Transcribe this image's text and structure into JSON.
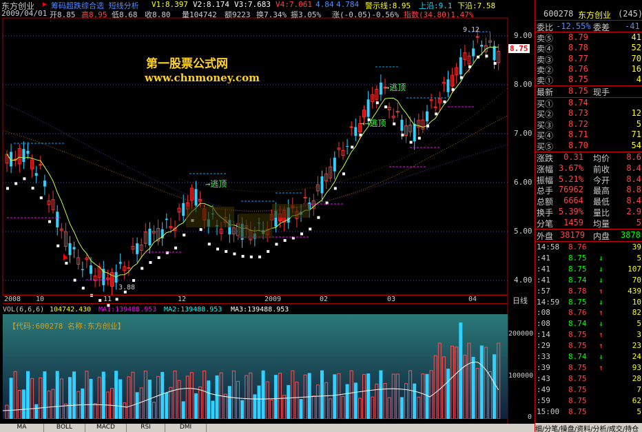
{
  "header": {
    "stock_name": "东方创业",
    "formula": "筹码超跌综合选 短线分析",
    "v1": "V1:8.397",
    "v2": "V2:8.174",
    "v3": "V3:7.683",
    "v4": "V4:7.061",
    "v5": "4.84",
    "v6": "4.784",
    "warn": "警示线:8.95",
    "upper": "上沿:9.1",
    "lower": "下沿:7.58",
    "date": "2009/04/01",
    "open": "开8.85",
    "high": "高8.95",
    "low": "低8.68",
    "close": "收8.80",
    "volume": "量104742",
    "amount": "额9223",
    "turnover": "换7.34%",
    "amplitude": "振3.05%",
    "change": "涨(-0.05)-0.56%",
    "index": "指数(34.80)1.47%"
  },
  "watermark": {
    "title": "第一股票公式网",
    "url": "www.chnmoney.com"
  },
  "price_axis": {
    "labels": [
      "9.00",
      "8.00",
      "7.00",
      "6.00",
      "5.00",
      "4.00"
    ],
    "current": "8.75",
    "high_mark": "9.12",
    "low_mark": "3.88"
  },
  "annotations": [
    "逃顶",
    "逃顶",
    "逃顶"
  ],
  "time_axis": [
    "2008",
    "10",
    "11",
    "12",
    "2009",
    "02",
    "03",
    "04"
  ],
  "time_axis_right": "日线",
  "volume_header": {
    "title": "VOL(6,6,6)",
    "vol": "104742.430",
    "ma1": "MA1:139488.953",
    "ma2": "MA2:139488.953",
    "ma3": "MA3:139488.953",
    "code_line": "【代码:600278 名称:东方创业】"
  },
  "volume_axis": [
    "200000",
    "100000",
    "0"
  ],
  "tabs": [
    "MA",
    "BOLL",
    "MACD",
    "RSI",
    "DMI"
  ],
  "quote": {
    "code": "600278",
    "name": "东方创业",
    "num": "(245)",
    "weibi_label": "委比",
    "weibi": "-12.55%",
    "weicha_label": "委差",
    "weicha": "-41",
    "asks": [
      {
        "label": "卖⑤",
        "price": "8.79",
        "vol": "41"
      },
      {
        "label": "卖④",
        "price": "8.78",
        "vol": "52"
      },
      {
        "label": "卖③",
        "price": "8.77",
        "vol": "70"
      },
      {
        "label": "卖②",
        "price": "8.76",
        "vol": "16"
      },
      {
        "label": "卖①",
        "price": "8.75",
        "vol": "4"
      }
    ],
    "last_label": "最新",
    "last": "8.75",
    "last_extra": "现手",
    "bids": [
      {
        "label": "买①",
        "price": "8.74",
        "vol": ""
      },
      {
        "label": "买②",
        "price": "8.73",
        "vol": "12"
      },
      {
        "label": "买③",
        "price": "8.72",
        "vol": "5"
      },
      {
        "label": "买④",
        "price": "8.71",
        "vol": "71"
      },
      {
        "label": "买⑤",
        "price": "8.70",
        "vol": "54"
      }
    ],
    "stats": [
      {
        "l1": "涨跌",
        "v1": "0.31",
        "l2": "均价",
        "v2": "8.6"
      },
      {
        "l1": "涨幅",
        "v1": "3.67%",
        "l2": "前收",
        "v2": "8.4"
      },
      {
        "l1": "振幅",
        "v1": "5.21%",
        "l2": "今开",
        "v2": "8.4"
      },
      {
        "l1": "总手",
        "v1": "76962",
        "l2": "最高",
        "v2": "8.8"
      },
      {
        "l1": "总额",
        "v1": "6664",
        "l2": "最低",
        "v2": "8.4"
      },
      {
        "l1": "换手",
        "v1": "5.39%",
        "l2": "量比",
        "v2": "2.9"
      },
      {
        "l1": "分笔",
        "v1": "1459",
        "l2": "均量",
        "v2": "5"
      }
    ],
    "outer_label": "外盘",
    "outer": "38179",
    "inner_label": "内盘",
    "inner": "3878",
    "ticks": [
      {
        "t": "14:58",
        "p": "8.76",
        "a": "",
        "v": "39"
      },
      {
        "t": ":41",
        "p": "8.75",
        "a": "↓",
        "v": "5"
      },
      {
        "t": ":41",
        "p": "8.75",
        "a": "↓",
        "v": "107"
      },
      {
        "t": ":41",
        "p": "8.74",
        "a": "↓",
        "v": "70"
      },
      {
        "t": ":57",
        "p": "8.78",
        "a": "↑",
        "v": "439"
      },
      {
        "t": "14:59",
        "p": "8.75",
        "a": "↓",
        "v": "10"
      },
      {
        "t": ":08",
        "p": "8.76",
        "a": "↑",
        "v": "82"
      },
      {
        "t": ":08",
        "p": "8.74",
        "a": "↓",
        "v": "5"
      },
      {
        "t": ":14",
        "p": "8.75",
        "a": "↑",
        "v": "3"
      },
      {
        "t": ":29",
        "p": "8.75",
        "a": "↑",
        "v": "23"
      },
      {
        "t": ":33",
        "p": "8.74",
        "a": "↓",
        "v": "24"
      },
      {
        "t": ":39",
        "p": "8.75",
        "a": "↑",
        "v": "93"
      },
      {
        "t": ":43",
        "p": "8.75",
        "a": "",
        "v": "28"
      },
      {
        "t": ":49",
        "p": "8.75",
        "a": "",
        "v": "7"
      },
      {
        "t": ":59",
        "p": "8.75",
        "a": "",
        "v": "62"
      },
      {
        "t": "15:00",
        "p": "8.75",
        "a": "",
        "v": "5"
      }
    ],
    "bottom_text": "细/分笔/操盘/资料/分析/成交/持仓"
  }
}
